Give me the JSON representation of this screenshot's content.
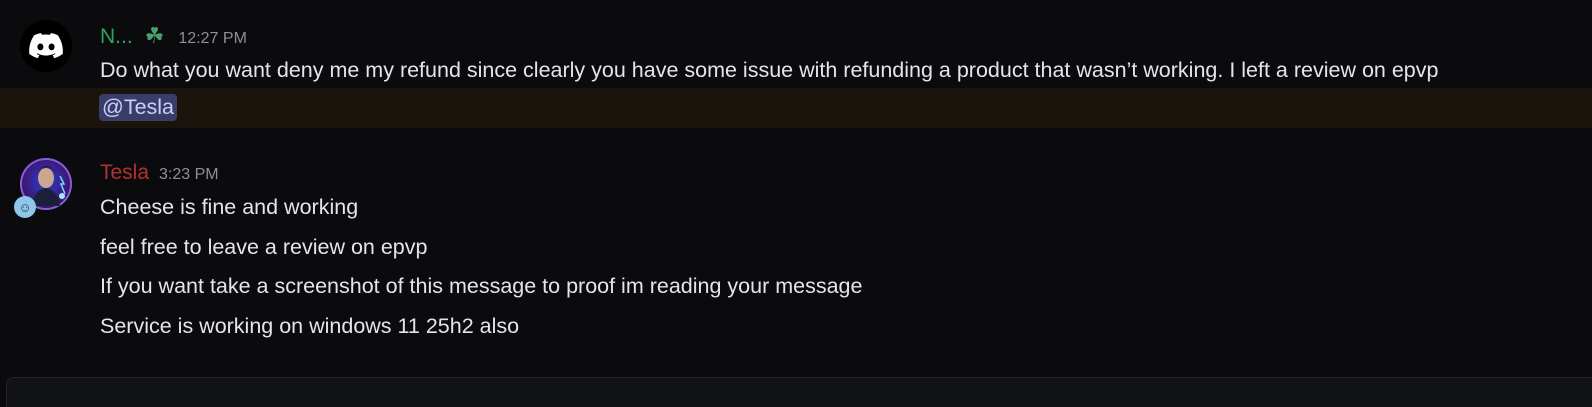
{
  "messages": [
    {
      "author": "N...",
      "author_color": "#2ea55d",
      "badge_icon": "clover-icon",
      "time": "12:27 PM",
      "avatar_icon": "discord-logo-icon",
      "lines": [
        "Do what you want deny me my refund since clearly you have some issue with refunding a product that wasn’t working. I left a review on epvp"
      ],
      "mention": "@Tesla"
    },
    {
      "author": "Tesla",
      "author_color": "#b3322f",
      "time": "3:23 PM",
      "avatar_icon": "tesla-portrait-avatar",
      "lines": [
        "Cheese is fine and working",
        "feel free to leave a review on epvp",
        "If you want take a screenshot of this message to proof im reading your message",
        "Service is working on windows 11 25h2 also"
      ]
    }
  ],
  "colors": {
    "background": "#0b0b0e",
    "mention_highlight": "#1a140d",
    "mention_pill": "#3a3e66"
  }
}
